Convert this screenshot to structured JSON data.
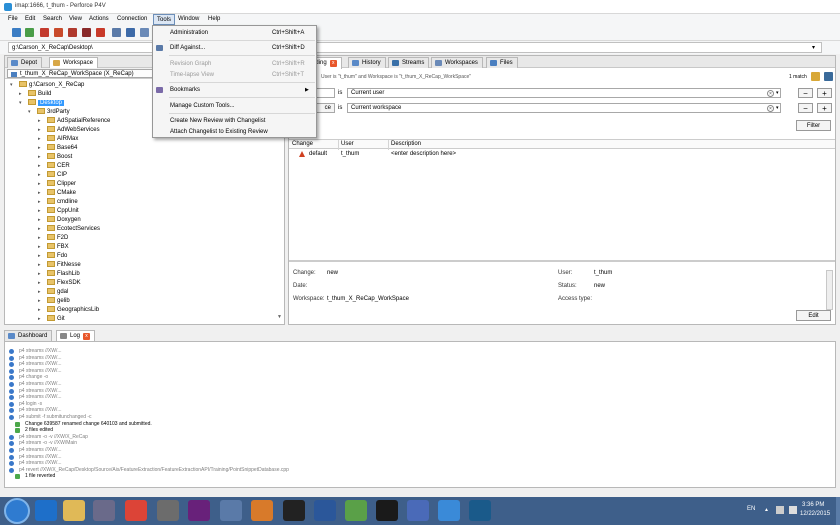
{
  "window": {
    "title": "imap:1666, t_thum - Perforce P4V"
  },
  "menubar": {
    "items": [
      "File",
      "Edit",
      "Search",
      "View",
      "Actions",
      "Connection",
      "Tools",
      "Window",
      "Help"
    ],
    "active": "Tools"
  },
  "path": {
    "value": "g:\\Carson_X_ReCap\\Desktop\\"
  },
  "left": {
    "tabs": [
      "Depot",
      "Workspace"
    ],
    "workspace_selector": "t_thum_X_ReCap_WorkSpace (X_ReCap)",
    "tree": [
      {
        "label": "g:\\Carson_X_ReCap",
        "level": 0,
        "expander": "minus"
      },
      {
        "label": "Build",
        "level": 1,
        "expander": "plus"
      },
      {
        "label": "Desktop",
        "level": 1,
        "expander": "minus",
        "selected": true
      },
      {
        "label": "3rdParty",
        "level": 2,
        "expander": "minus"
      },
      {
        "label": "AdSpatialReference",
        "level": 3,
        "expander": "plus"
      },
      {
        "label": "AdWebServices",
        "level": 3,
        "expander": "plus"
      },
      {
        "label": "AIRMax",
        "level": 3,
        "expander": "plus"
      },
      {
        "label": "Base64",
        "level": 3,
        "expander": "plus"
      },
      {
        "label": "Boost",
        "level": 3,
        "expander": "plus"
      },
      {
        "label": "CER",
        "level": 3,
        "expander": "plus"
      },
      {
        "label": "CIP",
        "level": 3,
        "expander": "plus"
      },
      {
        "label": "Clipper",
        "level": 3,
        "expander": "plus"
      },
      {
        "label": "CMake",
        "level": 3,
        "expander": "plus"
      },
      {
        "label": "cmdline",
        "level": 3,
        "expander": "plus"
      },
      {
        "label": "CppUnit",
        "level": 3,
        "expander": "plus"
      },
      {
        "label": "Doxygen",
        "level": 3,
        "expander": "plus"
      },
      {
        "label": "EcotectServices",
        "level": 3,
        "expander": "plus"
      },
      {
        "label": "F2D",
        "level": 3,
        "expander": "plus"
      },
      {
        "label": "FBX",
        "level": 3,
        "expander": "plus"
      },
      {
        "label": "Fdo",
        "level": 3,
        "expander": "plus"
      },
      {
        "label": "FitNesse",
        "level": 3,
        "expander": "plus"
      },
      {
        "label": "FlashLib",
        "level": 3,
        "expander": "plus"
      },
      {
        "label": "FlexSDK",
        "level": 3,
        "expander": "plus"
      },
      {
        "label": "gdal",
        "level": 3,
        "expander": "plus"
      },
      {
        "label": "gelib",
        "level": 3,
        "expander": "plus"
      },
      {
        "label": "GeographicsLib",
        "level": 3,
        "expander": "plus"
      },
      {
        "label": "Git",
        "level": 3,
        "expander": "plus"
      }
    ]
  },
  "right": {
    "tabs": [
      {
        "label": "nding",
        "closable": true
      },
      {
        "label": "History"
      },
      {
        "label": "Streams"
      },
      {
        "label": "Workspaces"
      },
      {
        "label": "Files"
      }
    ],
    "filter_summary": "User is \"t_thum\" and Workspace is \"t_thum_X_ReCap_WorkSpace\"",
    "match_count": "1 match",
    "filters": [
      {
        "field": "",
        "op": "is",
        "value": "Current user"
      },
      {
        "field": "ce",
        "op": "is",
        "value": "Current workspace"
      }
    ],
    "filter_button": "Filter",
    "columns": [
      "Change",
      "User",
      "Description"
    ],
    "rows": [
      {
        "change": "default",
        "user": "t_thum",
        "description": "<enter description here>"
      }
    ],
    "detail": {
      "change_label": "Change:",
      "change_value": "new",
      "date_label": "Date:",
      "date_value": "",
      "workspace_label": "Workspace:",
      "workspace_value": "t_thum_X_ReCap_WorkSpace",
      "user_label": "User:",
      "user_value": "t_thum",
      "status_label": "Status:",
      "status_value": "new",
      "access_label": "Access type:",
      "access_value": "",
      "edit_button": "Edit"
    }
  },
  "menu_tools": {
    "items": [
      {
        "label": "Administration",
        "shortcut": "Ctrl+Shift+A",
        "enabled": true
      },
      {
        "label": "Diff Against...",
        "shortcut": "Ctrl+Shift+D",
        "enabled": true,
        "icon": "diff-icon"
      },
      {
        "label": "Revision Graph",
        "shortcut": "Ctrl+Shift+R",
        "enabled": false
      },
      {
        "label": "Time-lapse View",
        "shortcut": "Ctrl+Shift+T",
        "enabled": false
      },
      {
        "label": "Bookmarks",
        "shortcut": "",
        "enabled": true,
        "submenu": true,
        "icon": "bookmark-icon"
      },
      {
        "label": "Manage Custom Tools...",
        "shortcut": "",
        "enabled": true
      },
      {
        "label": "Create New Review with Changelist",
        "shortcut": "",
        "enabled": true
      },
      {
        "label": "Attach Changelist to Existing Review",
        "shortcut": "",
        "enabled": true
      }
    ]
  },
  "log": {
    "tabs": [
      {
        "label": "Dashboard"
      },
      {
        "label": "Log",
        "closable": true
      }
    ],
    "lines": [
      {
        "text": "p4 streams //XW/...",
        "style": "cmd"
      },
      {
        "text": "p4 streams //XW/...",
        "style": "cmd"
      },
      {
        "text": "p4 streams //XW/...",
        "style": "cmd"
      },
      {
        "text": "p4 streams //XW/...",
        "style": "cmd"
      },
      {
        "text": "p4 change -o",
        "style": "cmd"
      },
      {
        "text": "p4 streams //XW/...",
        "style": "cmd"
      },
      {
        "text": "p4 streams //XW/...",
        "style": "cmd"
      },
      {
        "text": "p4 streams //XW/...",
        "style": "cmd"
      },
      {
        "text": "p4 login -s",
        "style": "cmd"
      },
      {
        "text": "p4 streams //XW/...",
        "style": "cmd"
      },
      {
        "text": "p4 submit -f submitunchanged -c",
        "style": "cmd"
      },
      {
        "text": "Change 639587 renamed change 640103 and submitted.",
        "style": "result"
      },
      {
        "text": "2 files edited",
        "style": "result"
      },
      {
        "text": "p4 stream -o -v //XW/X_ReCap",
        "style": "cmd"
      },
      {
        "text": "p4 stream -o -v //XW/Main",
        "style": "cmd"
      },
      {
        "text": "p4 streams //XW/...",
        "style": "cmd"
      },
      {
        "text": "p4 streams //XW/...",
        "style": "cmd"
      },
      {
        "text": "p4 streams //XW/...",
        "style": "cmd"
      },
      {
        "text": "p4 revert //XW/X_ReCap/Desktop/Source/Ais/FeatureExtraction/FeatureExtractionAPI/Training/PointSnippetDatabase.cpp",
        "style": "cmd"
      },
      {
        "text": "1 file reverted",
        "style": "result"
      }
    ]
  },
  "tray": {
    "lang": "EN",
    "time": "3:36 PM",
    "date": "12/22/2015"
  },
  "colors": {
    "accent": "#3399ff",
    "close_badge": "#e8562a",
    "taskbar": "#3e5f8a"
  }
}
